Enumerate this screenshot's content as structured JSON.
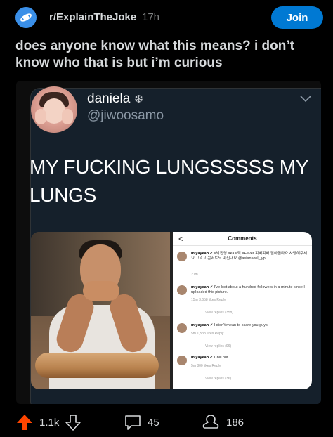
{
  "header": {
    "subreddit": "r/ExplainTheJoke",
    "time_ago": "17h",
    "join_label": "Join",
    "subreddit_icon": "planet-icon"
  },
  "post": {
    "title": "does anyone know what this means? i don’t know who that is but i’m curious"
  },
  "tweet": {
    "display_name": "daniela",
    "name_emoji": "❆",
    "handle": "@jiwoosamo",
    "text": "MY FUCKING LUNGSSSSS MY LUNGS"
  },
  "screenshot": {
    "title": "Comments",
    "back": "<",
    "comments": [
      {
        "user": "miyayeah",
        "text": "#박진영 aka #탁 #Fever 피버피버 달아올라요 사랑해주세요 그리고 콘서트도 마신대요 @asiansoul_jyp",
        "meta": "21m"
      },
      {
        "user": "miyayeah",
        "text": "I've lost about a hundred followers in a minute since I uploaded this picture.",
        "meta": "15m   3,658 likes   Reply",
        "replies": "View replies (358)"
      },
      {
        "user": "miyayeah",
        "text": "I didn't mean to scare you guys",
        "meta": "5m   1,533 likes   Reply",
        "replies": "View replies (96)"
      },
      {
        "user": "miyayeah",
        "text": "Chill out",
        "meta": "5m   800 likes   Reply",
        "replies": "View replies (36)"
      }
    ]
  },
  "actions": {
    "upvotes": "1.1k",
    "comments": "45",
    "shares": "186",
    "upvote_color": "#ff4500"
  }
}
